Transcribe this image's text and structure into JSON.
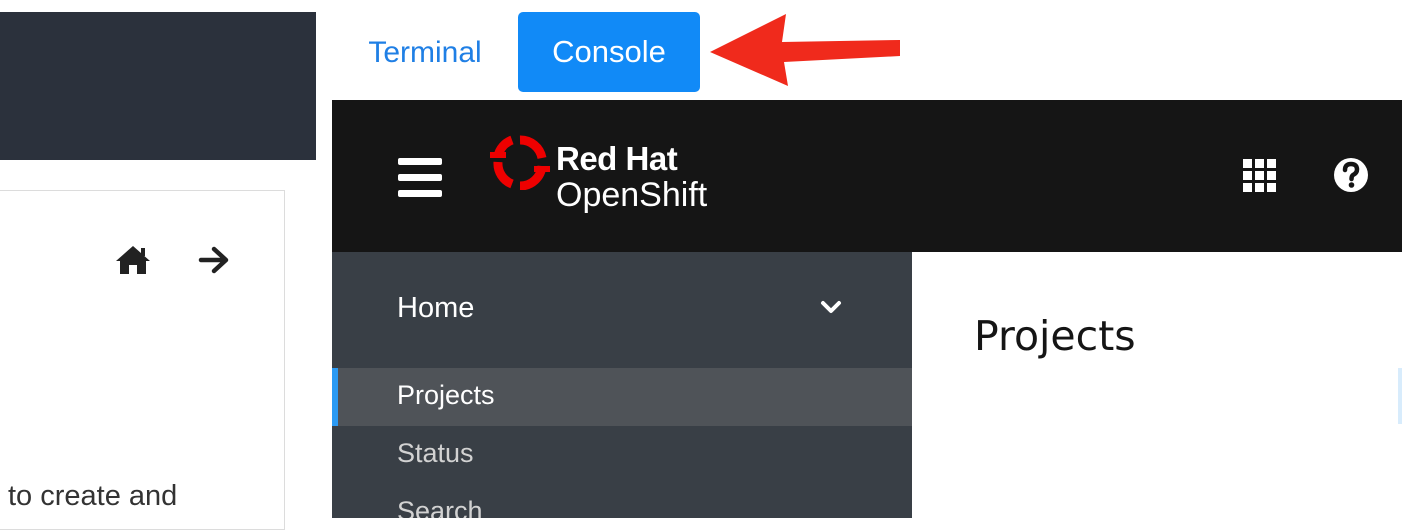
{
  "tabs": {
    "terminal": "Terminal",
    "console": "Console",
    "active": "Console"
  },
  "left_pane": {
    "text_fragment": "to create and"
  },
  "console": {
    "brand_line1": "Red Hat",
    "brand_line2": "OpenShift",
    "nav_section": "Home",
    "nav_items": [
      "Projects",
      "Status",
      "Search"
    ],
    "active_item": "Projects",
    "page_title": "Projects"
  },
  "icons": {
    "left_home": "home-icon",
    "left_forward": "arrow-right-icon",
    "annotation": "red-arrow-icon",
    "menu": "hamburger-icon",
    "logo": "redhat-logo-icon",
    "apps": "app-launcher-grid-icon",
    "help": "help-question-icon",
    "nav_toggle": "chevron-down-icon"
  },
  "colors": {
    "console_tab_bg": "#118af7",
    "terminal_tab_text": "#1f7fe5",
    "annotation_arrow": "#f02a1c",
    "masthead_bg": "#151515",
    "sidebar_bg": "#393f46",
    "active_item_bg": "#4f5358",
    "active_item_border": "#2b9af3",
    "redhat_red": "#ee0000"
  }
}
